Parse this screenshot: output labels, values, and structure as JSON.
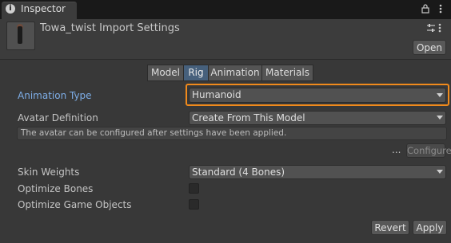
{
  "tab": {
    "label": "Inspector"
  },
  "header": {
    "title": "Towa_twist Import Settings",
    "open_label": "Open"
  },
  "tabs": [
    {
      "label": "Model"
    },
    {
      "label": "Rig",
      "active": true
    },
    {
      "label": "Animation"
    },
    {
      "label": "Materials"
    }
  ],
  "fields": {
    "animation_type": {
      "label": "Animation Type",
      "value": "Humanoid"
    },
    "avatar_definition": {
      "label": "Avatar Definition",
      "value": "Create From This Model"
    },
    "help_text": "The avatar can be configured after settings have been applied.",
    "ellipsis": "...",
    "configure_label": "Configure...",
    "skin_weights": {
      "label": "Skin Weights",
      "value": "Standard (4 Bones)"
    },
    "optimize_bones": {
      "label": "Optimize Bones",
      "checked": false
    },
    "optimize_game_objects": {
      "label": "Optimize Game Objects",
      "checked": false
    }
  },
  "footer": {
    "revert_label": "Revert",
    "apply_label": "Apply"
  },
  "colors": {
    "highlight": "#f08a1c",
    "active_tab": "#46607c",
    "label_blue": "#7eaee8"
  },
  "icons": [
    "info-icon",
    "lock-icon",
    "more-icon",
    "settings-icon",
    "chevron-down-icon"
  ]
}
